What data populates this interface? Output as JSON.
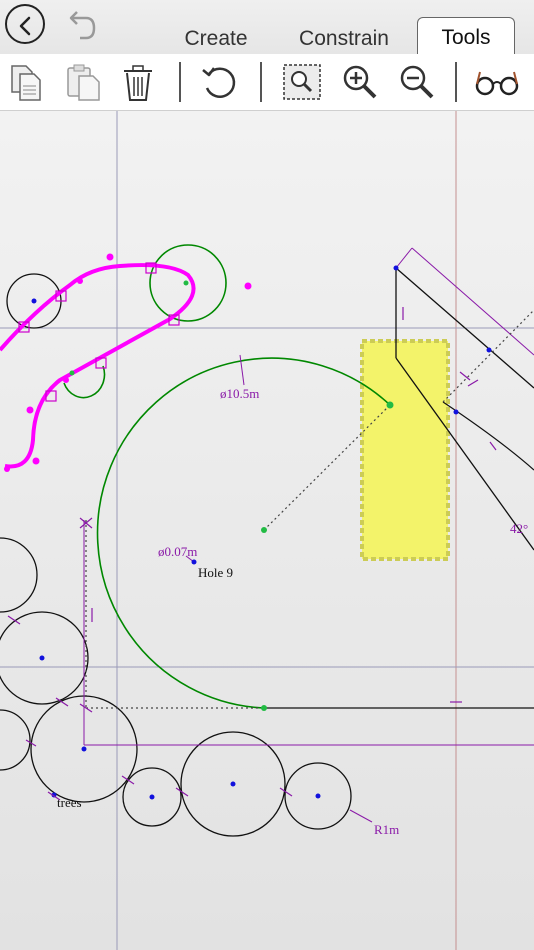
{
  "nav": {
    "back_icon": "chevron-left-icon",
    "undo_icon": "undo-icon"
  },
  "tabs": [
    {
      "label": "Create",
      "active": false
    },
    {
      "label": "Constrain",
      "active": false
    },
    {
      "label": "Tools",
      "active": true
    }
  ],
  "toolbar": {
    "tools": [
      {
        "name": "copy-button",
        "icon": "copy-icon"
      },
      {
        "name": "paste-button",
        "icon": "paste-icon"
      },
      {
        "name": "delete-button",
        "icon": "trash-icon"
      },
      {
        "name": "rotate-button",
        "icon": "rotate-icon"
      },
      {
        "name": "zoom-window-button",
        "icon": "zoom-window-icon"
      },
      {
        "name": "zoom-in-button",
        "icon": "zoom-in-icon"
      },
      {
        "name": "zoom-out-button",
        "icon": "zoom-out-icon"
      },
      {
        "name": "view-button",
        "icon": "glasses-icon"
      }
    ]
  },
  "canvas": {
    "labels": {
      "diameter_large": "ø10.5m",
      "diameter_small": "ø0.07m",
      "hole": "Hole 9",
      "trees": "trees",
      "radius": "R1m",
      "angle": "42°"
    }
  },
  "colors": {
    "magenta": "#ff00ff",
    "green": "#008800",
    "purple": "#8a1aa8",
    "dimension": "#8a1aa8",
    "highlight": "#f3f36a",
    "point_blue": "#1111dd",
    "guide": "#9a9ab8"
  }
}
